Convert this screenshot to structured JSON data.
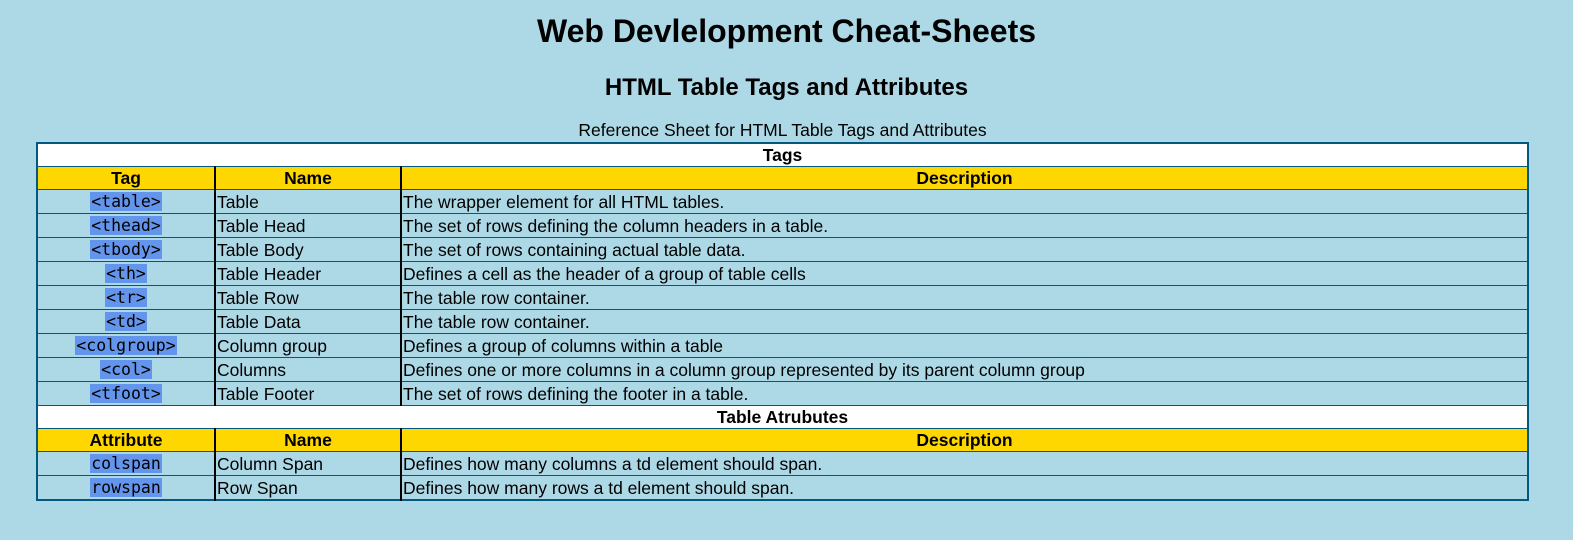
{
  "page": {
    "title": "Web Devlelopment Cheat-Sheets",
    "subtitle": "HTML Table Tags and Attributes"
  },
  "table": {
    "caption": "Reference Sheet for HTML Table Tags and Attributes",
    "tags_section": {
      "title": "Tags",
      "headers": [
        "Tag",
        "Name",
        "Description"
      ],
      "rows": [
        {
          "code": "<table>",
          "name": "Table",
          "description": "The wrapper element for all HTML tables."
        },
        {
          "code": "<thead>",
          "name": "Table Head",
          "description": "The set of rows defining the column headers in a table."
        },
        {
          "code": "<tbody>",
          "name": "Table Body",
          "description": "The set of rows containing actual table data."
        },
        {
          "code": "<th>",
          "name": "Table Header",
          "description": "Defines a cell as the header of a group of table cells"
        },
        {
          "code": "<tr>",
          "name": "Table Row",
          "description": "The table row container."
        },
        {
          "code": "<td>",
          "name": "Table Data",
          "description": "The table row container."
        },
        {
          "code": "<colgroup>",
          "name": "Column group",
          "description": "Defines a group of columns within a table"
        },
        {
          "code": "<col>",
          "name": "Columns",
          "description": "Defines one or more columns in a column group represented by its parent column group"
        },
        {
          "code": "<tfoot>",
          "name": "Table Footer",
          "description": "The set of rows defining the footer in a table."
        }
      ]
    },
    "attributes_section": {
      "title": "Table Atrubutes",
      "headers": [
        "Attribute",
        "Name",
        "Description"
      ],
      "rows": [
        {
          "code": "colspan",
          "name": "Column Span",
          "description": "Defines how many columns a td element should span."
        },
        {
          "code": "rowspan",
          "name": "Row Span",
          "description": "Defines how many rows a td element should span."
        }
      ]
    }
  },
  "colors": {
    "page_background": "#add8e6",
    "header_row": "#ffd700",
    "section_row": "#ffffff",
    "code_highlight": "#6495ed",
    "table_border": "#03587f"
  }
}
